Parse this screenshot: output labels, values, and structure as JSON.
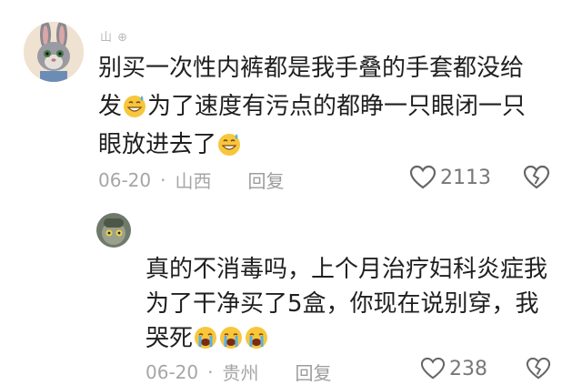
{
  "comments": [
    {
      "username": "山 ⊕",
      "line1": "别买一次性内裤都是我手叠的手套都没给",
      "line2a": "发",
      "line2b": "为了速度有污点的都睁一只眼闭一只",
      "line3": "眼放进去了",
      "date": "06-20",
      "location": "山西",
      "reply_label": "回复",
      "likes": "2113"
    },
    {
      "username": "",
      "line1": "真的不消毒吗，上个月治疗妇科炎症我",
      "line2": "为了干净买了5盒，你现在说别穿，我",
      "line3": "哭死",
      "date": "06-20",
      "location": "贵州",
      "reply_label": "回复",
      "likes": "238"
    }
  ],
  "colors": {
    "meta": "#a6a6a6",
    "text": "#1f1f1f"
  }
}
